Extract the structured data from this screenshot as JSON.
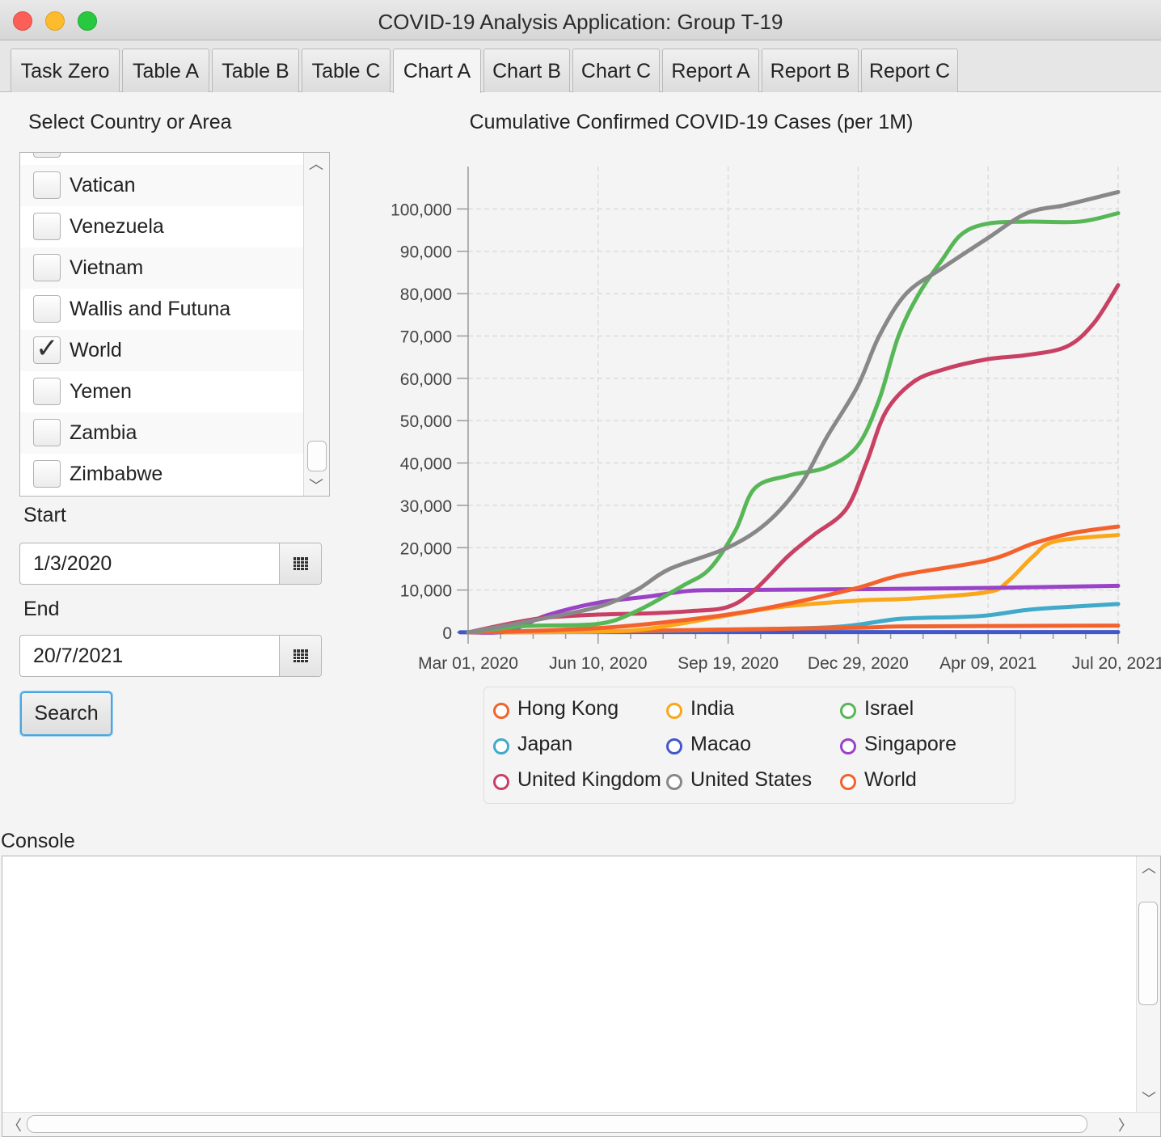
{
  "window": {
    "title": "COVID-19 Analysis Application: Group T-19"
  },
  "tabs": [
    {
      "label": "Task Zero",
      "active": false
    },
    {
      "label": "Table A",
      "active": false
    },
    {
      "label": "Table B",
      "active": false
    },
    {
      "label": "Table C",
      "active": false
    },
    {
      "label": "Chart A",
      "active": true
    },
    {
      "label": "Chart B",
      "active": false
    },
    {
      "label": "Chart C",
      "active": false
    },
    {
      "label": "Report A",
      "active": false
    },
    {
      "label": "Report B",
      "active": false
    },
    {
      "label": "Report C",
      "active": false
    }
  ],
  "left_panel": {
    "select_label": "Select Country or Area",
    "countries": [
      {
        "name": "Vatican",
        "checked": false
      },
      {
        "name": "Venezuela",
        "checked": false
      },
      {
        "name": "Vietnam",
        "checked": false
      },
      {
        "name": "Wallis and Futuna",
        "checked": false
      },
      {
        "name": "World",
        "checked": true
      },
      {
        "name": "Yemen",
        "checked": false
      },
      {
        "name": "Zambia",
        "checked": false
      },
      {
        "name": "Zimbabwe",
        "checked": false
      }
    ],
    "start_label": "Start",
    "start_value": "1/3/2020",
    "end_label": "End",
    "end_value": "20/7/2021",
    "search_label": "Search"
  },
  "console": {
    "label": "Console",
    "text": ""
  },
  "colors": {
    "hong_kong": "#f3622d",
    "india": "#fba71b",
    "israel": "#57b757",
    "japan": "#41a9c9",
    "macao": "#4258c9",
    "singapore": "#9a42c8",
    "united_kingdom": "#c84164",
    "united_states": "#888888",
    "world": "#f3622d"
  },
  "chart_data": {
    "type": "line",
    "title": "Cumulative Confirmed COVID-19 Cases (per 1M)",
    "xlabel": "",
    "ylabel": "",
    "x_tick_labels": [
      "Mar 01, 2020",
      "Jun 10, 2020",
      "Sep 19, 2020",
      "Dec 29, 2020",
      "Apr 09, 2021",
      "Jul 20, 2021"
    ],
    "x_range": [
      "2020-03-01",
      "2021-07-20"
    ],
    "ylim": [
      0,
      110000
    ],
    "y_ticks": [
      0,
      10000,
      20000,
      30000,
      40000,
      50000,
      60000,
      70000,
      80000,
      90000,
      100000
    ],
    "y_tick_labels": [
      "0",
      "10,000",
      "20,000",
      "30,000",
      "40,000",
      "50,000",
      "60,000",
      "70,000",
      "80,000",
      "90,000",
      "100,000"
    ],
    "grid": true,
    "legend_position": "bottom",
    "series": [
      {
        "name": "Hong Kong",
        "color": "#f3622d",
        "points": [
          [
            "2020-03-01",
            0
          ],
          [
            "2020-06-10",
            200
          ],
          [
            "2020-09-19",
            700
          ],
          [
            "2020-12-29",
            1100
          ],
          [
            "2021-02-01",
            1400
          ],
          [
            "2021-04-09",
            1500
          ],
          [
            "2021-07-20",
            1600
          ]
        ]
      },
      {
        "name": "India",
        "color": "#fba71b",
        "points": [
          [
            "2020-03-01",
            0
          ],
          [
            "2020-06-10",
            200
          ],
          [
            "2020-07-20",
            900
          ],
          [
            "2020-09-19",
            4000
          ],
          [
            "2020-10-30",
            6000
          ],
          [
            "2020-12-29",
            7500
          ],
          [
            "2021-02-10",
            8000
          ],
          [
            "2021-04-09",
            9500
          ],
          [
            "2021-04-25",
            12000
          ],
          [
            "2021-05-15",
            18000
          ],
          [
            "2021-06-01",
            21500
          ],
          [
            "2021-07-20",
            23000
          ]
        ]
      },
      {
        "name": "Israel",
        "color": "#57b757",
        "points": [
          [
            "2020-03-01",
            0
          ],
          [
            "2020-04-15",
            1500
          ],
          [
            "2020-06-10",
            2000
          ],
          [
            "2020-07-10",
            5000
          ],
          [
            "2020-08-15",
            11000
          ],
          [
            "2020-09-05",
            15000
          ],
          [
            "2020-09-25",
            24000
          ],
          [
            "2020-10-10",
            34000
          ],
          [
            "2020-11-05",
            37000
          ],
          [
            "2020-12-05",
            39000
          ],
          [
            "2020-12-29",
            44000
          ],
          [
            "2021-01-15",
            55000
          ],
          [
            "2021-01-30",
            70000
          ],
          [
            "2021-02-15",
            80000
          ],
          [
            "2021-03-05",
            88000
          ],
          [
            "2021-03-20",
            94000
          ],
          [
            "2021-04-09",
            96500
          ],
          [
            "2021-05-10",
            97000
          ],
          [
            "2021-06-20",
            97000
          ],
          [
            "2021-07-20",
            99000
          ]
        ]
      },
      {
        "name": "Japan",
        "color": "#41a9c9",
        "points": [
          [
            "2020-03-01",
            0
          ],
          [
            "2020-06-10",
            150
          ],
          [
            "2020-09-19",
            600
          ],
          [
            "2020-11-30",
            1100
          ],
          [
            "2020-12-29",
            1800
          ],
          [
            "2021-01-31",
            3200
          ],
          [
            "2021-03-15",
            3600
          ],
          [
            "2021-04-09",
            4000
          ],
          [
            "2021-05-10",
            5300
          ],
          [
            "2021-06-10",
            6000
          ],
          [
            "2021-07-20",
            6700
          ]
        ]
      },
      {
        "name": "Macao",
        "color": "#4258c9",
        "points": [
          [
            "2020-03-01",
            0
          ],
          [
            "2020-04-15",
            60
          ],
          [
            "2021-07-20",
            80
          ]
        ]
      },
      {
        "name": "Singapore",
        "color": "#9a42c8",
        "points": [
          [
            "2020-03-01",
            0
          ],
          [
            "2020-04-01",
            300
          ],
          [
            "2020-05-01",
            4000
          ],
          [
            "2020-06-10",
            7000
          ],
          [
            "2020-07-20",
            8500
          ],
          [
            "2020-08-20",
            9800
          ],
          [
            "2020-09-19",
            10000
          ],
          [
            "2020-12-29",
            10200
          ],
          [
            "2021-04-09",
            10500
          ],
          [
            "2021-07-20",
            11000
          ]
        ]
      },
      {
        "name": "United Kingdom",
        "color": "#c84164",
        "points": [
          [
            "2020-03-01",
            0
          ],
          [
            "2020-04-01",
            2000
          ],
          [
            "2020-05-01",
            3500
          ],
          [
            "2020-06-10",
            4200
          ],
          [
            "2020-07-20",
            4500
          ],
          [
            "2020-08-20",
            5000
          ],
          [
            "2020-09-19",
            6000
          ],
          [
            "2020-10-10",
            10000
          ],
          [
            "2020-11-05",
            18000
          ],
          [
            "2020-11-25",
            23000
          ],
          [
            "2020-12-20",
            29000
          ],
          [
            "2021-01-05",
            40000
          ],
          [
            "2021-01-20",
            52000
          ],
          [
            "2021-02-10",
            59000
          ],
          [
            "2021-03-05",
            62000
          ],
          [
            "2021-04-09",
            64500
          ],
          [
            "2021-05-10",
            65500
          ],
          [
            "2021-06-10",
            67500
          ],
          [
            "2021-07-01",
            73000
          ],
          [
            "2021-07-20",
            82000
          ]
        ]
      },
      {
        "name": "United States",
        "color": "#888888",
        "points": [
          [
            "2020-03-01",
            0
          ],
          [
            "2020-04-15",
            2500
          ],
          [
            "2020-06-10",
            6000
          ],
          [
            "2020-07-10",
            10000
          ],
          [
            "2020-08-05",
            15000
          ],
          [
            "2020-09-19",
            20000
          ],
          [
            "2020-10-20",
            26000
          ],
          [
            "2020-11-15",
            35000
          ],
          [
            "2020-12-05",
            46000
          ],
          [
            "2020-12-29",
            58000
          ],
          [
            "2021-01-15",
            70000
          ],
          [
            "2021-02-05",
            80000
          ],
          [
            "2021-03-05",
            86000
          ],
          [
            "2021-04-09",
            93000
          ],
          [
            "2021-05-10",
            99000
          ],
          [
            "2021-06-10",
            101000
          ],
          [
            "2021-07-20",
            104000
          ]
        ]
      },
      {
        "name": "World",
        "color": "#f3622d",
        "points": [
          [
            "2020-03-01",
            0
          ],
          [
            "2020-04-15",
            300
          ],
          [
            "2020-06-10",
            1000
          ],
          [
            "2020-07-20",
            2000
          ],
          [
            "2020-09-19",
            4200
          ],
          [
            "2020-11-01",
            6500
          ],
          [
            "2020-12-29",
            10500
          ],
          [
            "2021-02-01",
            13500
          ],
          [
            "2021-04-09",
            17000
          ],
          [
            "2021-05-15",
            21000
          ],
          [
            "2021-06-15",
            23500
          ],
          [
            "2021-07-20",
            25000
          ]
        ]
      }
    ]
  }
}
